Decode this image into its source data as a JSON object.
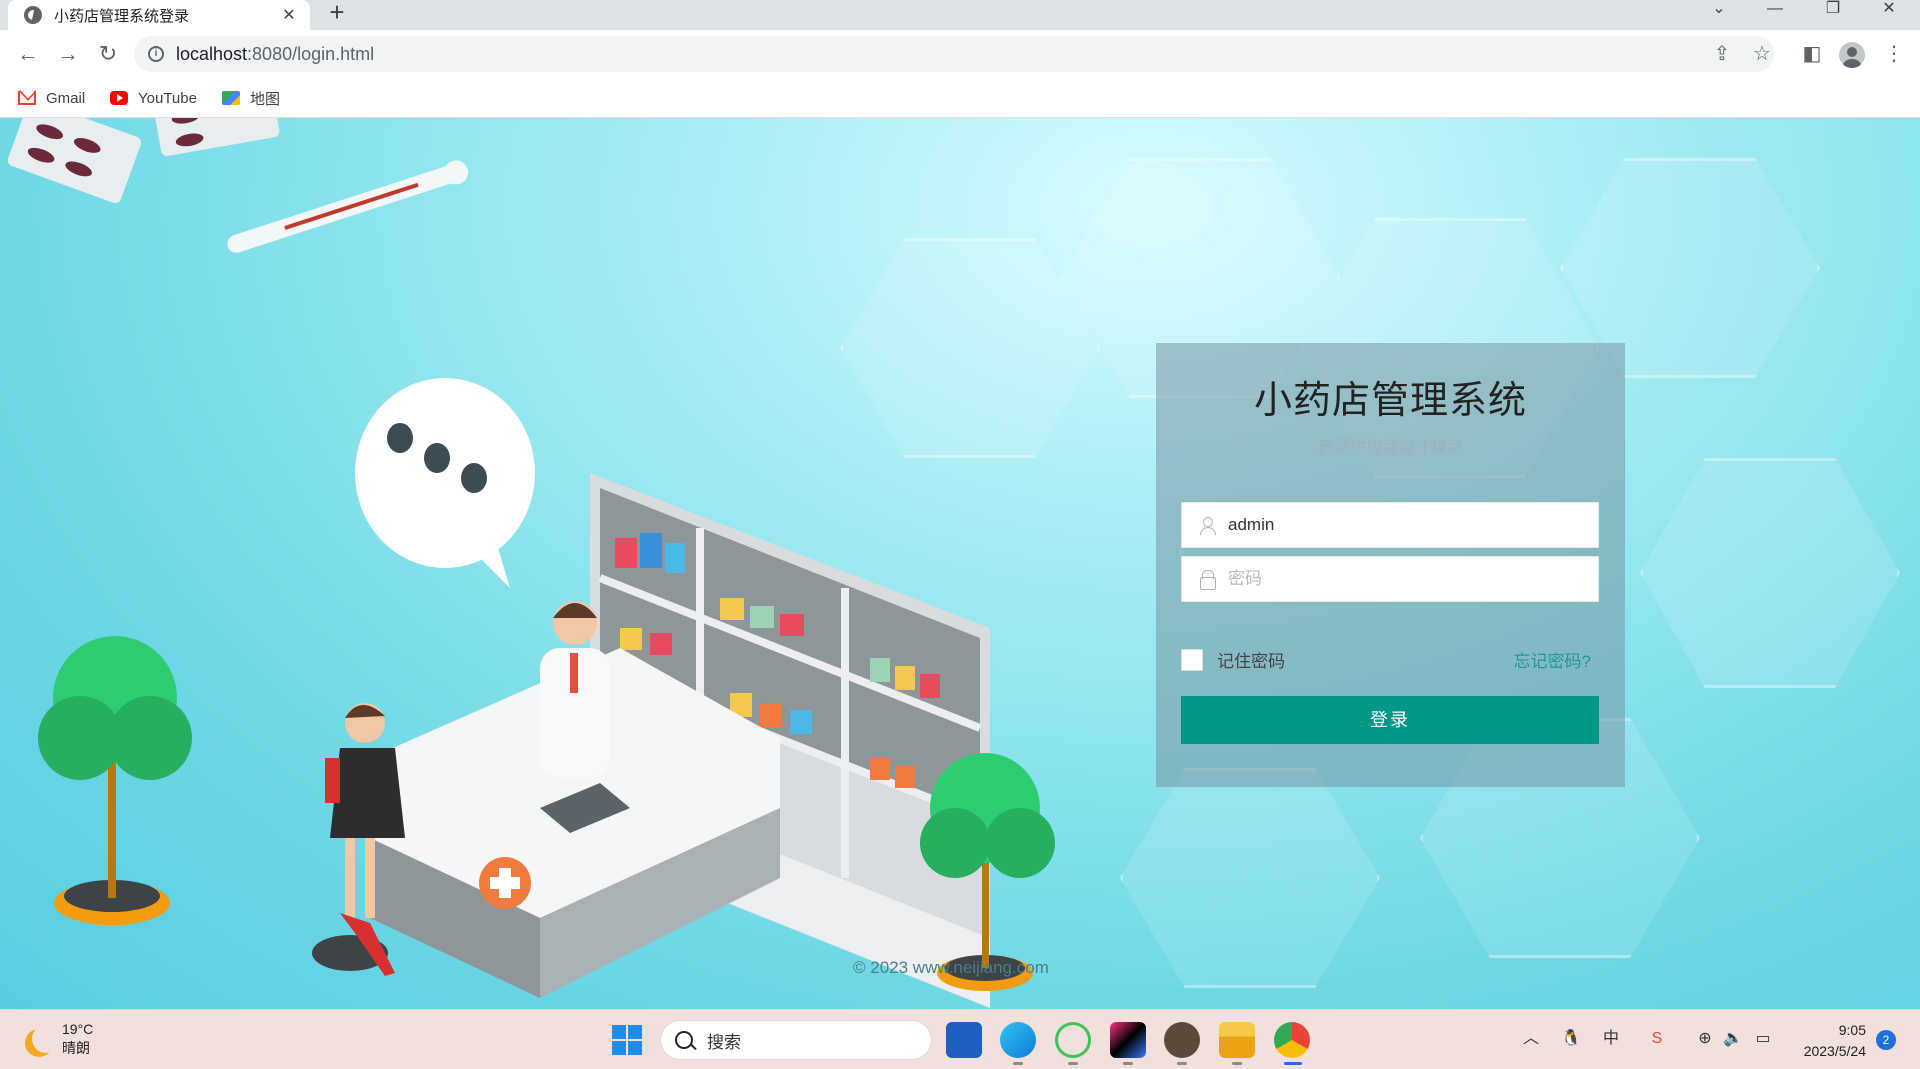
{
  "browser": {
    "tab_title": "小药店管理系统登录",
    "tab_close": "✕",
    "new_tab": "+",
    "url_host": "localhost",
    "url_path": ":8080/login.html",
    "bookmarks": [
      {
        "label": "Gmail",
        "icon": "gmail-icon"
      },
      {
        "label": "YouTube",
        "icon": "youtube-icon"
      },
      {
        "label": "地图",
        "icon": "maps-icon"
      }
    ]
  },
  "login": {
    "title": "小药店管理系统",
    "subtitle": "药品供应商设计规范",
    "username_value": "admin",
    "password_placeholder": "密码",
    "remember_label": "记住密码",
    "forgot_label": "忘记密码?",
    "submit_label": "登录",
    "accent_color": "#009688"
  },
  "footer": {
    "copyright": "© 2023   www.neijiang.com"
  },
  "taskbar": {
    "weather_temp": "19°C",
    "weather_desc": "晴朗",
    "search_label": "搜索",
    "time": "9:05",
    "date": "2023/5/24",
    "notification_count": "2"
  }
}
